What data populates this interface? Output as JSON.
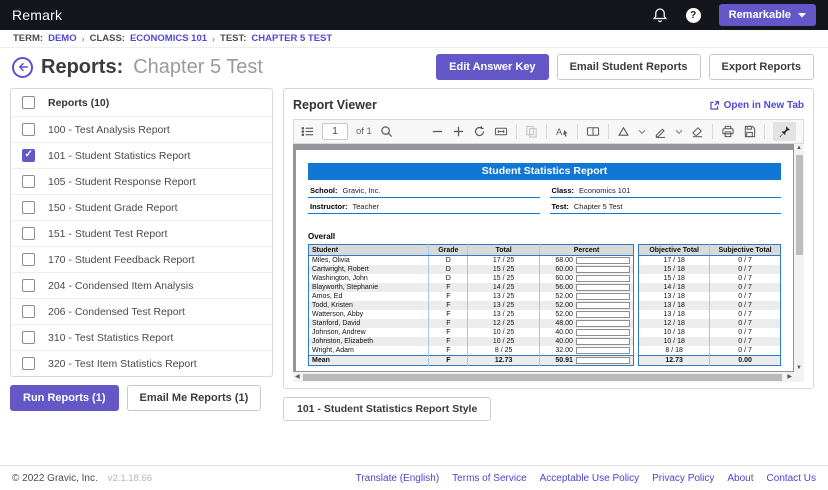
{
  "topbar": {
    "brand": "Remark",
    "account": "Remarkable"
  },
  "breadcrumb": [
    {
      "label": "TERM:",
      "link": "DEMO"
    },
    {
      "label": "CLASS:",
      "link": "ECONOMICS 101"
    },
    {
      "label": "TEST:",
      "link": "CHAPTER 5 TEST"
    }
  ],
  "page": {
    "title": "Reports:",
    "subtitle": "Chapter 5 Test",
    "edit_answer_key": "Edit Answer Key",
    "email_student_reports": "Email Student Reports",
    "export_reports": "Export Reports"
  },
  "reports_panel": {
    "header": "Reports (10)",
    "items": [
      {
        "label": "100 - Test Analysis Report",
        "checked": false
      },
      {
        "label": "101 - Student Statistics Report",
        "checked": true
      },
      {
        "label": "105 - Student Response Report",
        "checked": false
      },
      {
        "label": "150 - Student Grade Report",
        "checked": false
      },
      {
        "label": "151 - Student Test Report",
        "checked": false
      },
      {
        "label": "170 - Student Feedback Report",
        "checked": false
      },
      {
        "label": "204 - Condensed Item Analysis",
        "checked": false
      },
      {
        "label": "206 - Condensed Test Report",
        "checked": false
      },
      {
        "label": "310 - Test Statistics Report",
        "checked": false
      },
      {
        "label": "320 - Test Item Statistics Report",
        "checked": false
      }
    ],
    "run_button": "Run Reports (1)",
    "email_button": "Email Me Reports (1)"
  },
  "viewer": {
    "title": "Report Viewer",
    "open_in_new_tab": "Open in New Tab",
    "toolbar": {
      "page_number": "1",
      "page_count_label": "of 1"
    },
    "style_tab": "101 - Student Statistics Report Style"
  },
  "report": {
    "banner": "Student Statistics Report",
    "info": {
      "school_label": "School:",
      "school": "Gravic, Inc.",
      "class_label": "Class:",
      "class": "Economics 101",
      "instructor_label": "Instructor:",
      "instructor": "Teacher",
      "test_label": "Test:",
      "test": "Chapter 5 Test"
    },
    "section_title": "Overall",
    "table": {
      "columns": [
        "Student",
        "Grade",
        "Total",
        "Percent",
        "Objective Total",
        "Subjective Total"
      ],
      "rows": [
        {
          "student": "Miles, Olivia",
          "grade": "D",
          "total": "17 / 25",
          "percent": "68.00",
          "percent_value": 68,
          "objective": "17 / 18",
          "subjective": "0 / 7"
        },
        {
          "student": "Cartwright, Robert",
          "grade": "D",
          "total": "15 / 25",
          "percent": "60.00",
          "percent_value": 60,
          "objective": "15 / 18",
          "subjective": "0 / 7"
        },
        {
          "student": "Washington, John",
          "grade": "D",
          "total": "15 / 25",
          "percent": "60.00",
          "percent_value": 60,
          "objective": "15 / 18",
          "subjective": "0 / 7"
        },
        {
          "student": "Blayworth, Stephanie",
          "grade": "F",
          "total": "14 / 25",
          "percent": "56.00",
          "percent_value": 56,
          "objective": "14 / 18",
          "subjective": "0 / 7"
        },
        {
          "student": "Amos, Ed",
          "grade": "F",
          "total": "13 / 25",
          "percent": "52.00",
          "percent_value": 52,
          "objective": "13 / 18",
          "subjective": "0 / 7"
        },
        {
          "student": "Todd, Kristen",
          "grade": "F",
          "total": "13 / 25",
          "percent": "52.00",
          "percent_value": 52,
          "objective": "13 / 18",
          "subjective": "0 / 7"
        },
        {
          "student": "Watterson, Abby",
          "grade": "F",
          "total": "13 / 25",
          "percent": "52.00",
          "percent_value": 52,
          "objective": "13 / 18",
          "subjective": "0 / 7"
        },
        {
          "student": "Stanford, David",
          "grade": "F",
          "total": "12 / 25",
          "percent": "48.00",
          "percent_value": 48,
          "objective": "12 / 18",
          "subjective": "0 / 7"
        },
        {
          "student": "Johnson, Andrew",
          "grade": "F",
          "total": "10 / 25",
          "percent": "40.00",
          "percent_value": 40,
          "objective": "10 / 18",
          "subjective": "0 / 7"
        },
        {
          "student": "Johnston, Elizabeth",
          "grade": "F",
          "total": "10 / 25",
          "percent": "40.00",
          "percent_value": 40,
          "objective": "10 / 18",
          "subjective": "0 / 7"
        },
        {
          "student": "Wright, Adam",
          "grade": "F",
          "total": "8 / 25",
          "percent": "32.00",
          "percent_value": 32,
          "objective": "8 / 18",
          "subjective": "0 / 7"
        }
      ],
      "mean_row": {
        "student": "Mean",
        "grade": "F",
        "total": "12.73",
        "percent": "50.91",
        "percent_value": 50.91,
        "objective": "12.73",
        "subjective": "0.00"
      }
    }
  },
  "footer": {
    "copyright": "© 2022 Gravic, Inc.",
    "version": "v2.1.18.66",
    "links": [
      "Translate (English)",
      "Terms of Service",
      "Acceptable Use Policy",
      "Privacy Policy",
      "About",
      "Contact Us"
    ]
  },
  "colors": {
    "accent_purple": "#6458c9",
    "link_purple": "#4f49d4",
    "report_blue": "#1177d5",
    "topbar_bg": "#15151d"
  }
}
